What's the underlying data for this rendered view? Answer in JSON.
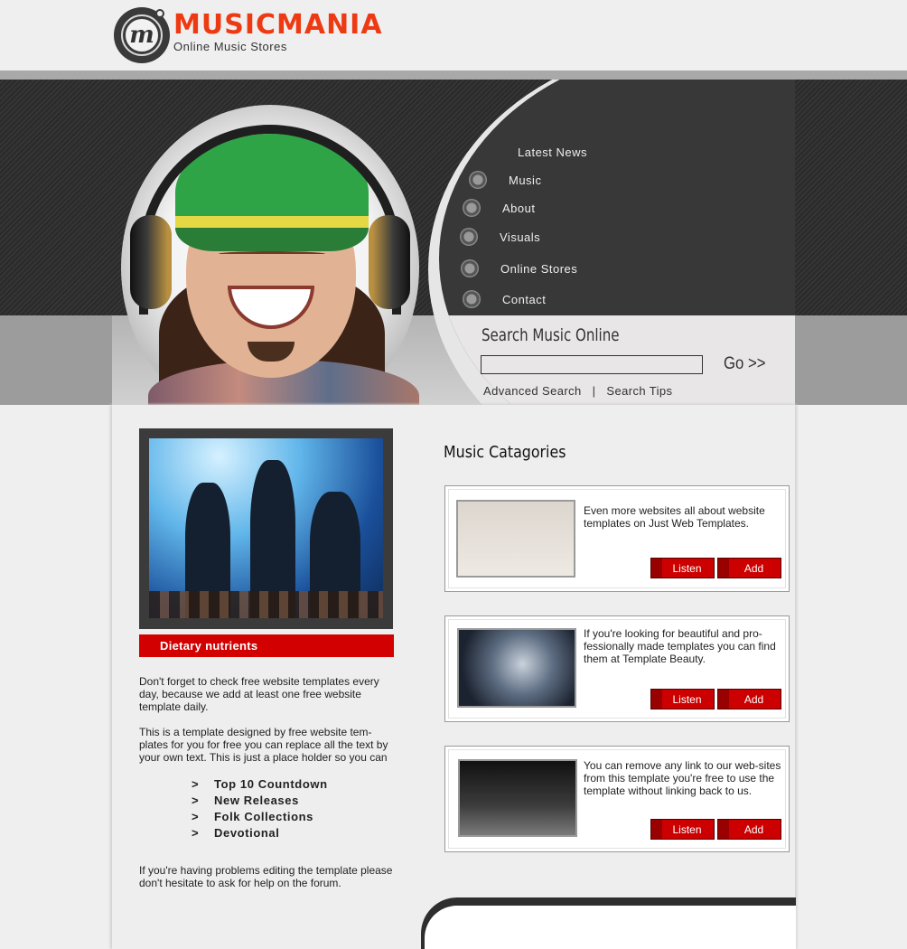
{
  "header": {
    "brand": "MUSICMANIA",
    "tagline": "Online Music Stores",
    "logo_letter": "m"
  },
  "nav": {
    "title": "Latest News",
    "items": [
      {
        "label": "Music"
      },
      {
        "label": "About"
      },
      {
        "label": "Visuals"
      },
      {
        "label": "Online Stores"
      },
      {
        "label": "Contact"
      }
    ]
  },
  "search": {
    "title": "Search Music Online",
    "input_value": "",
    "go_label": "Go >>",
    "advanced_label": "Advanced Search",
    "separator": "|",
    "tips_label": "Search Tips"
  },
  "left": {
    "bar_label": "Dietary nutrients",
    "para1": "Don't forget to check free website templates every day, because we add at least one free website template daily.",
    "para2": "This is a template designed by free website tem-plates for you for free you can replace all the text by your own text. This is just a place holder so you can",
    "list": [
      {
        "arrow": ">",
        "label": "Top 10 Countdown"
      },
      {
        "arrow": ">",
        "label": "New Releases"
      },
      {
        "arrow": ">",
        "label": "Folk Collections"
      },
      {
        "arrow": ">",
        "label": "Devotional"
      }
    ],
    "para3": "If you're having problems editing the template please don't hesitate to ask for help on the forum."
  },
  "categories": {
    "title": "Music Catagories",
    "cards": [
      {
        "text": "Even more websites all about website templates on Just Web Templates.",
        "listen": "Listen",
        "add": "Add"
      },
      {
        "text": "If you're looking for beautiful and pro-fessionally made templates you can find them at Template Beauty.",
        "listen": "Listen",
        "add": "Add"
      },
      {
        "text": "You can remove any link to our web-sites from this template you're free to use the template without linking back to us.",
        "listen": "Listen",
        "add": "Add"
      }
    ]
  },
  "colors": {
    "brand": "#ee3a12",
    "accent_red": "#d20000",
    "dark_panel": "#383838"
  }
}
